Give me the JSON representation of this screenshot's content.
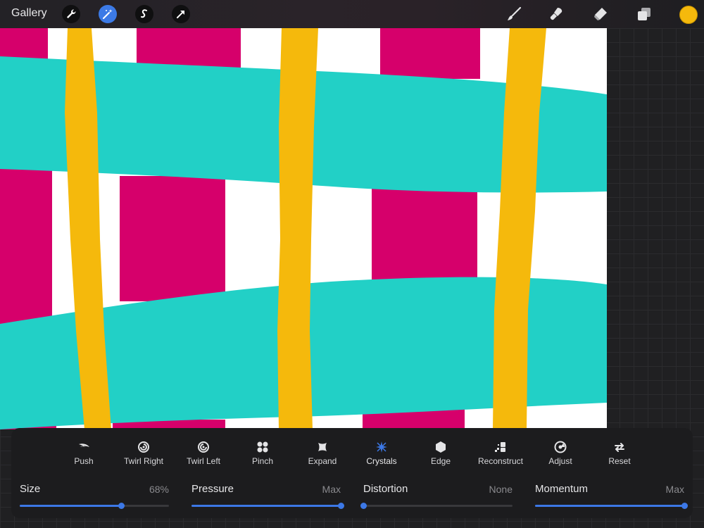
{
  "topbar": {
    "gallery_label": "Gallery",
    "left_tools": [
      "wrench-icon",
      "magic-wand-icon",
      "selection-icon",
      "transform-arrow-icon"
    ],
    "active_tool": "magic-wand-icon",
    "right_tools": [
      "brush-icon",
      "smudge-icon",
      "eraser-icon",
      "layers-icon"
    ],
    "current_color": "#f5b90c"
  },
  "liquify": {
    "modes": [
      {
        "label": "Push",
        "icon": "push-icon"
      },
      {
        "label": "Twirl Right",
        "icon": "twirl-right-icon"
      },
      {
        "label": "Twirl Left",
        "icon": "twirl-left-icon"
      },
      {
        "label": "Pinch",
        "icon": "pinch-icon"
      },
      {
        "label": "Expand",
        "icon": "expand-icon"
      },
      {
        "label": "Crystals",
        "icon": "crystals-icon"
      },
      {
        "label": "Edge",
        "icon": "edge-icon"
      },
      {
        "label": "Reconstruct",
        "icon": "reconstruct-icon"
      },
      {
        "label": "Adjust",
        "icon": "adjust-icon"
      },
      {
        "label": "Reset",
        "icon": "reset-icon"
      }
    ],
    "active_mode": "Crystals",
    "sliders": [
      {
        "name": "Size",
        "value_text": "68%",
        "level": 0.68
      },
      {
        "name": "Pressure",
        "value_text": "Max",
        "level": 1.0
      },
      {
        "name": "Distortion",
        "value_text": "None",
        "level": 0.0
      },
      {
        "name": "Momentum",
        "value_text": "Max",
        "level": 1.0
      }
    ]
  },
  "colors": {
    "accent": "#3c78e6",
    "magenta": "#d6006b",
    "teal": "#22d0c6",
    "yellow": "#f5b90c"
  }
}
